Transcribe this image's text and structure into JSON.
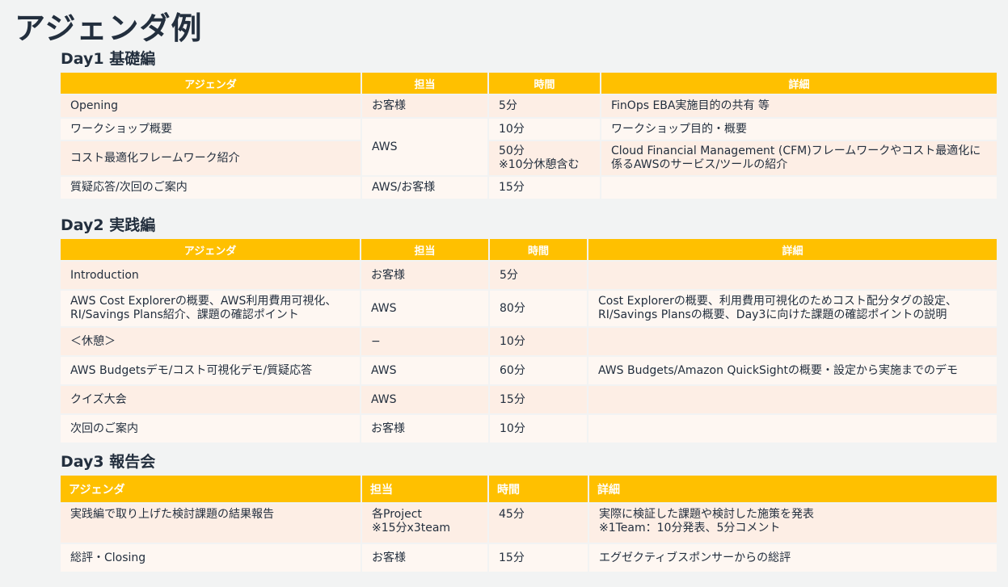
{
  "title": "アジェンダ例",
  "days": [
    {
      "heading": "Day1 基礎編",
      "headers": [
        "アジェンダ",
        "担当",
        "時間",
        "詳細"
      ],
      "rows": [
        {
          "agenda": "Opening",
          "owner": "お客様",
          "time": "5分",
          "time2": "",
          "detail": "FinOps EBA実施目的の共有 等",
          "detail2": ""
        },
        {
          "agenda": "ワークショップ概要",
          "owner": "AWS",
          "time": "10分",
          "time2": "",
          "detail": "ワークショップ目的・概要",
          "detail2": ""
        },
        {
          "agenda": "コスト最適化フレームワーク紹介",
          "owner": "",
          "time": "50分",
          "time2": "※10分休憩含む",
          "detail": "Cloud Financial Management (CFM)フレームワークやコスト最適化に",
          "detail2": "係るAWSのサービス/ツールの紹介"
        },
        {
          "agenda": "質疑応答/次回のご案内",
          "owner": "AWS/お客様",
          "time": "15分",
          "time2": "",
          "detail": "",
          "detail2": ""
        }
      ]
    },
    {
      "heading": "Day2 実践編",
      "headers": [
        "アジェンダ",
        "担当",
        "時間",
        "詳細"
      ],
      "rows": [
        {
          "agenda": "Introduction",
          "agenda2": "",
          "owner": "お客様",
          "time": "5分",
          "detail": "",
          "detail2": ""
        },
        {
          "agenda": "AWS Cost Explorerの概要、AWS利用費用可視化、",
          "agenda2": "RI/Savings Plans紹介、課題の確認ポイント",
          "owner": "AWS",
          "time": "80分",
          "detail": "Cost Explorerの概要、利用費用可視化のためコスト配分タグの設定、",
          "detail2": "RI/Savings Plansの概要、Day3に向けた課題の確認ポイントの説明"
        },
        {
          "agenda": "＜休憩＞",
          "agenda2": "",
          "owner": "−",
          "time": "10分",
          "detail": "",
          "detail2": ""
        },
        {
          "agenda": "AWS Budgetsデモ/コスト可視化デモ/質疑応答",
          "agenda2": "",
          "owner": "AWS",
          "time": "60分",
          "detail": "AWS Budgets/Amazon QuickSightの概要・設定から実施までのデモ",
          "detail2": ""
        },
        {
          "agenda": "クイズ大会",
          "agenda2": "",
          "owner": "AWS",
          "time": "15分",
          "detail": "",
          "detail2": ""
        },
        {
          "agenda": "次回のご案内",
          "agenda2": "",
          "owner": "お客様",
          "time": "10分",
          "detail": "",
          "detail2": ""
        }
      ]
    },
    {
      "heading": "Day3 報告会",
      "headers": [
        "アジェンダ",
        "担当",
        "時間",
        "詳細"
      ],
      "rows": [
        {
          "agenda": "実践編で取り上げた検討課題の結果報告",
          "owner": "各Project",
          "owner2": "※15分x3team",
          "time": "45分",
          "detail": "実際に検証した課題や検討した施策を発表",
          "detail2": "※1Team：10分発表、5分コメント"
        },
        {
          "agenda": "総評・Closing",
          "owner": "お客様",
          "owner2": "",
          "time": "15分",
          "detail": "エグゼクティブスポンサーからの総評",
          "detail2": ""
        }
      ]
    }
  ],
  "colors": {
    "header": "#ffc000",
    "row_odd": "#fdeee5",
    "row_even": "#fef7f2",
    "text": "#232f3e"
  }
}
